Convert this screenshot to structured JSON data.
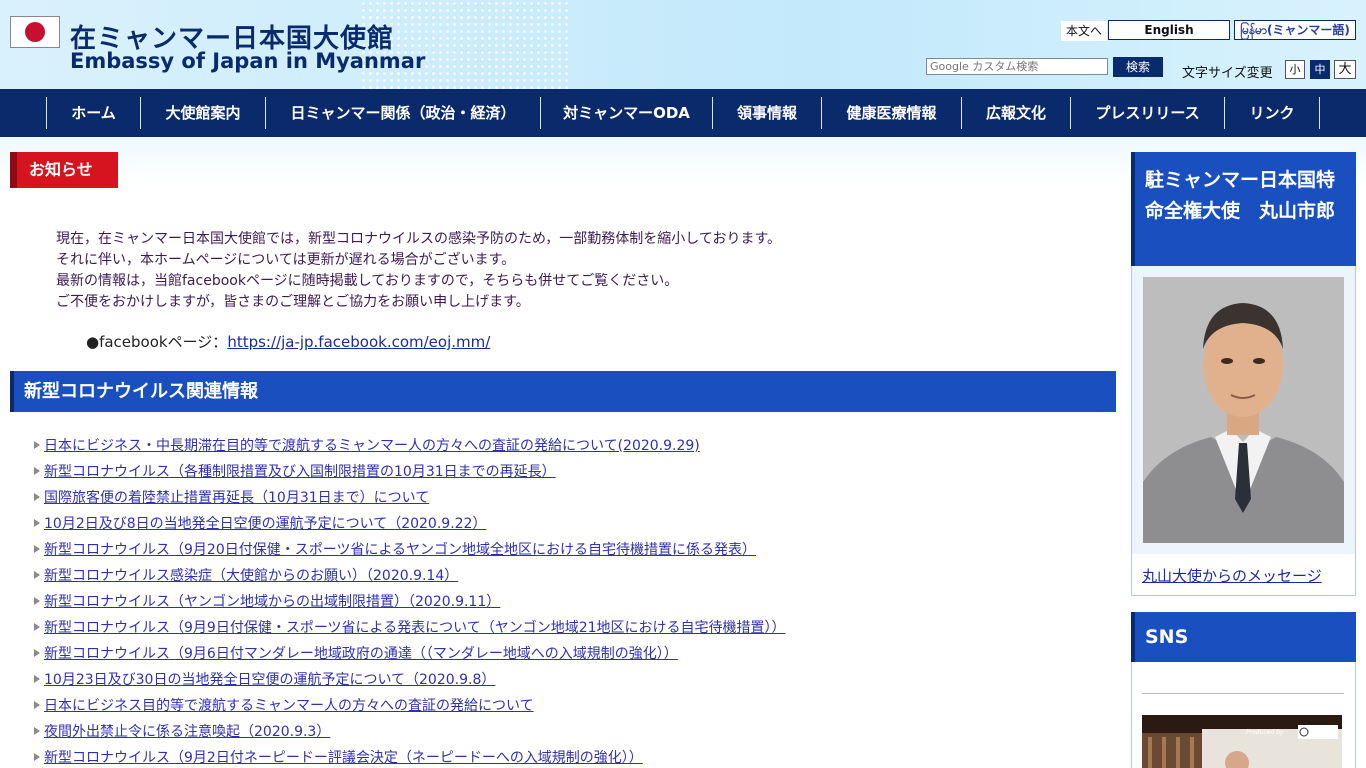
{
  "header": {
    "title": "在ミャンマー日本国大使館",
    "subtitle": "Embassy of Japan in Myanmar",
    "skip_link": "本文へ",
    "lang_en": "English",
    "lang_my": "မြန်မာ(ミャンマー語)",
    "search_placeholder": "Google カスタム検索",
    "search_button": "検索",
    "font_size_label": "文字サイズ変更",
    "font_small": "小",
    "font_medium": "中",
    "font_large": "大"
  },
  "nav": {
    "items": [
      "ホーム",
      "大使館案内",
      "日ミャンマー関係（政治・経済）",
      "対ミャンマーODA",
      "領事情報",
      "健康医療情報",
      "広報文化",
      "プレスリリース",
      "リンク"
    ]
  },
  "notice": {
    "title": "お知らせ",
    "lines": [
      "現在，在ミャンマー日本国大使館では，新型コロナウイルスの感染予防のため，一部勤務体制を縮小しております。",
      "それに伴い，本ホームページについては更新が遅れる場合がございます。",
      "最新の情報は，当館facebookページに随時掲載しておりますので，そちらも併せてご覧ください。",
      "ご不便をおかけしますが，皆さまのご理解とご協力をお願い申し上げます。"
    ],
    "fb_label": "●facebookページ：",
    "fb_url": "https://ja-jp.facebook.com/eoj.mm/"
  },
  "covid": {
    "title": "新型コロナウイルス関連情報",
    "items": [
      "日本にビジネス・中長期滞在目的等で渡航するミャンマー人の方々への査証の発給について(2020.9.29)",
      "新型コロナウイルス（各種制限措置及び入国制限措置の10月31日までの再延長）",
      "国際旅客便の着陸禁止措置再延長（10月31日まで）について",
      "10月2日及び8日の当地発全日空便の運航予定について（2020.9.22）",
      "新型コロナウイルス（9月20日付保健・スポーツ省によるヤンゴン地域全地区における自宅待機措置に係る発表）",
      "新型コロナウイルス感染症（大使館からのお願い）（2020.9.14）",
      "新型コロナウイルス（ヤンゴン地域からの出域制限措置）（2020.9.11）",
      "新型コロナウイルス（9月9日付保健・スポーツ省による発表について（ヤンゴン地域21地区における自宅待機措置））",
      "新型コロナウイルス（9月6日付マンダレー地域政府の通達（（マンダレー地域への入域規制の強化））",
      "10月23日及び30日の当地発全日空便の運航予定について（2020.9.8）",
      "日本にビジネス目的等で渡航するミャンマー人の方々への査証の発給について",
      "夜間外出禁止令に係る注意喚起（2020.9.3）",
      "新型コロナウイルス（9月2日付ネーピードー評議会決定（ネーピードーへの入域規制の強化））"
    ]
  },
  "sidebar": {
    "ambassador_title": "駐ミャンマー日本国特命全権大使　丸山市郎",
    "ambassador_message": "丸山大使からのメッセージ",
    "sns_title": "SNS",
    "video_caption": "Produced by"
  },
  "colors": {
    "navy": "#0b2a6b",
    "blue_heading": "#1a4fc0",
    "red_heading": "#d5141f",
    "link": "#3030b0"
  }
}
